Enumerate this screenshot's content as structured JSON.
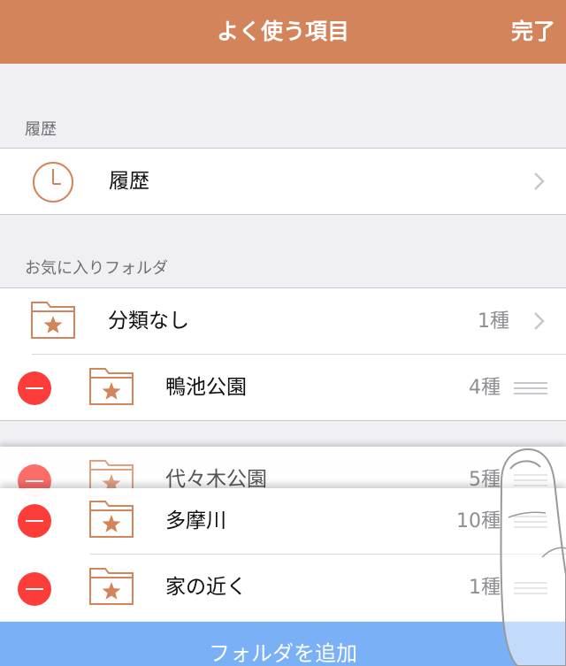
{
  "header": {
    "title": "よく使う項目",
    "done_label": "完了"
  },
  "history_section": {
    "header": "履歴",
    "item_label": "履歴"
  },
  "folders_section": {
    "header": "お気に入りフォルダ",
    "uncategorized": {
      "label": "分類なし",
      "count": "1種"
    },
    "folders": [
      {
        "label": "鴨池公園",
        "count": "4種"
      },
      {
        "label": "代々木公園",
        "count": "5種"
      },
      {
        "label": "多摩川",
        "count": "10種"
      },
      {
        "label": "家の近く",
        "count": "1種"
      }
    ]
  },
  "add_folder_label": "フォルダを追加",
  "colors": {
    "accent": "#d4845a",
    "delete": "#fc3d39",
    "add_bar": "#7ab0f5"
  },
  "icons": [
    "clock-icon",
    "folder-star-icon",
    "chevron-right-icon",
    "delete-minus-icon",
    "reorder-handle-icon",
    "finger-pointer"
  ]
}
